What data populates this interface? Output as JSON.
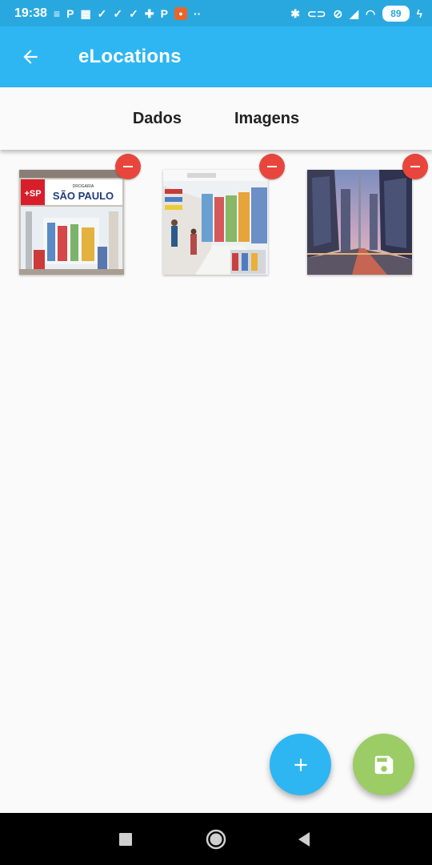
{
  "status_bar": {
    "time": "19:38",
    "battery": "89",
    "icons": [
      "data-speed-icon",
      "p-app-icon",
      "grid-app-icon",
      "check-icon",
      "check-icon",
      "check-icon",
      "puzzle-icon",
      "p-app-icon",
      "app-badge-icon",
      "more-dots-icon",
      "bluetooth-icon",
      "toggle-icon",
      "alarm-off-icon",
      "signal-icon",
      "wifi-icon",
      "battery-icon",
      "charging-icon"
    ]
  },
  "app_bar": {
    "title": "eLocations",
    "back_icon": "arrow-back-icon"
  },
  "tabs": [
    {
      "label": "Dados"
    },
    {
      "label": "Imagens"
    }
  ],
  "images": [
    {
      "name": "drogaria-sao-paulo-storefront",
      "sign_short": "+SP",
      "sign_top": "DROGARIA",
      "sign_main": "SÃO PAULO"
    },
    {
      "name": "pharmacy-aisle-interior"
    },
    {
      "name": "city-avenue-skyscrapers"
    }
  ],
  "colors": {
    "primary": "#2eb6f3",
    "status_bar": "#29a8e0",
    "remove": "#e8463d",
    "save": "#9ccc65"
  },
  "fabs": {
    "add_icon": "plus-icon",
    "save_icon": "floppy-disk-icon"
  },
  "nav_bar": {
    "icons": [
      "recent-apps-icon",
      "home-icon",
      "back-triangle-icon"
    ]
  }
}
